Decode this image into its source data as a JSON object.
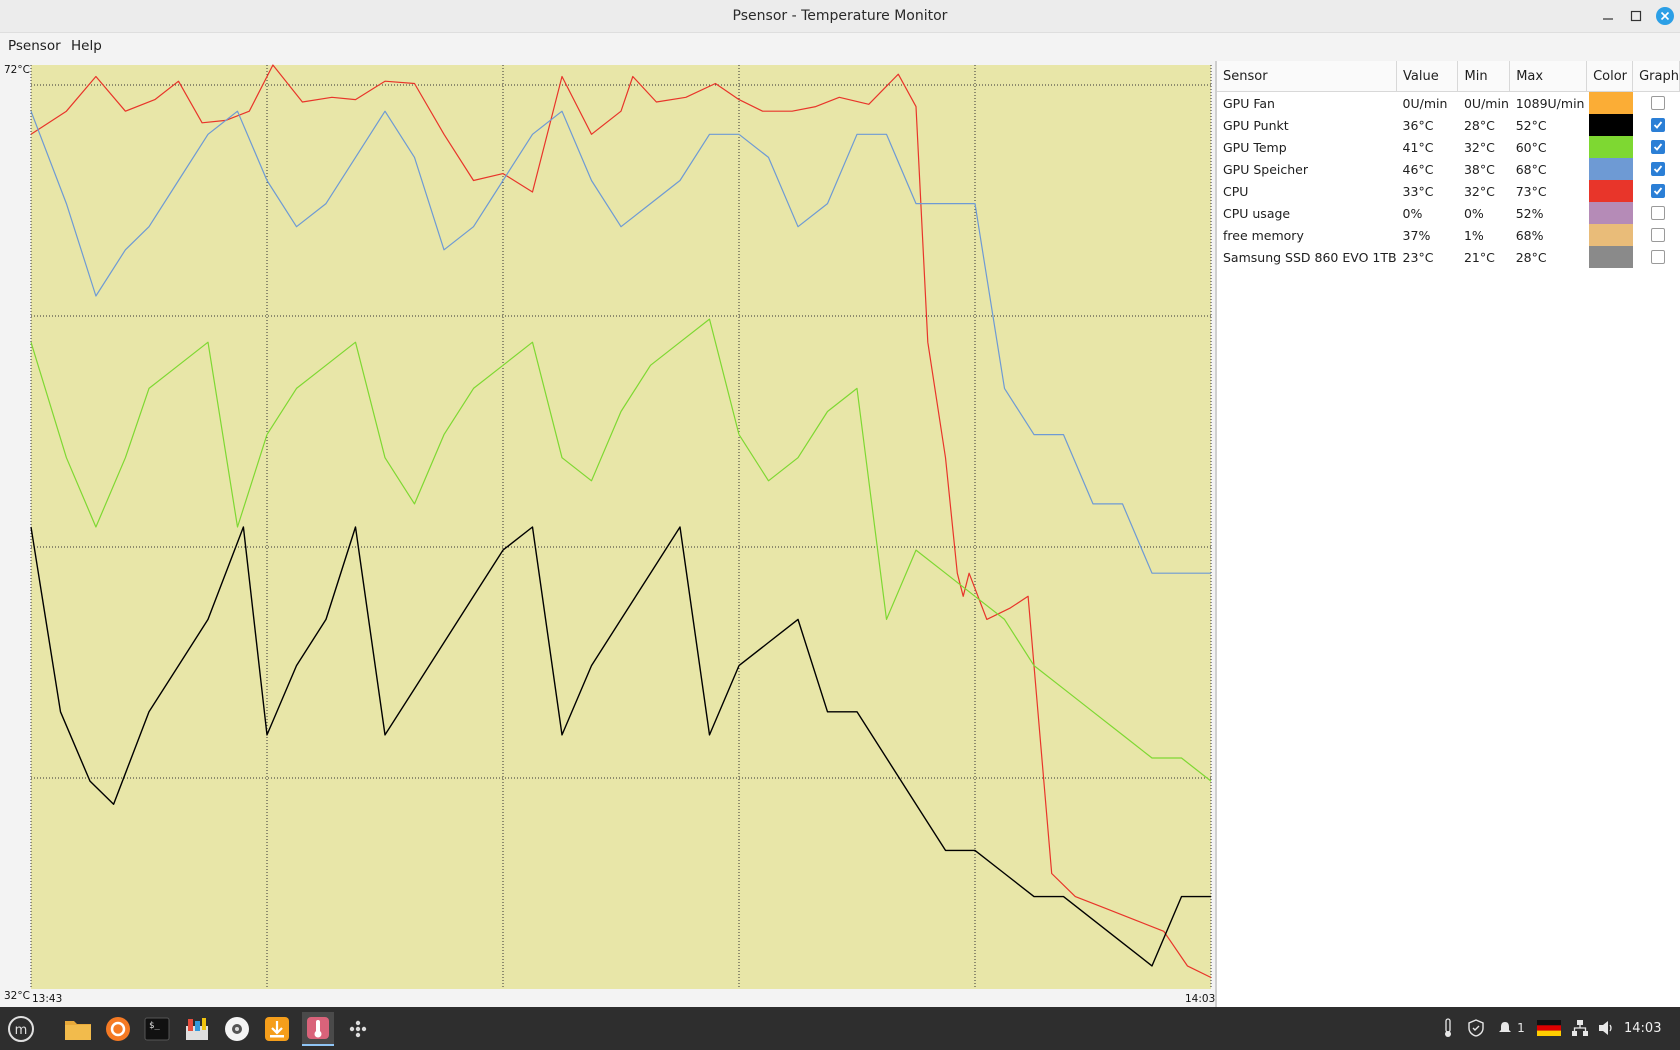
{
  "window": {
    "title": "Psensor - Temperature Monitor",
    "controls": [
      "minimize",
      "maximize",
      "close"
    ]
  },
  "menu": {
    "items": [
      "Psensor",
      "Help"
    ]
  },
  "graph": {
    "y_max_label": "72°C",
    "y_min_label": "32°C",
    "x_start_label": "13:43",
    "x_end_label": "14:03",
    "background_color": "#e8e6a8"
  },
  "chart_data": {
    "type": "line",
    "xlabel": "",
    "ylabel": "",
    "x_range": [
      "13:43",
      "14:03"
    ],
    "ylim": [
      32,
      72
    ],
    "series": [
      {
        "name": "CPU",
        "color": "#e8352a",
        "x": [
          0,
          0.6,
          1.1,
          1.6,
          2.1,
          2.5,
          2.9,
          3.3,
          3.7,
          4.1,
          4.6,
          5.1,
          5.5,
          6.0,
          6.5,
          7.0,
          7.5,
          8.0,
          8.5,
          9.0,
          9.5,
          10.0,
          10.2,
          10.6,
          11.1,
          11.6,
          12.0,
          12.4,
          12.9,
          13.3,
          13.7,
          14.2,
          14.7,
          15.0,
          15.2,
          15.5,
          15.7,
          15.8,
          15.9,
          16.2,
          16.6,
          16.9,
          17.3,
          17.7,
          18.2,
          18.7,
          19.2,
          19.6,
          20.0
        ],
        "values": [
          69,
          70,
          71.5,
          70,
          70.5,
          71.3,
          69.5,
          69.6,
          70,
          72,
          70.4,
          70.6,
          70.5,
          71.3,
          71.2,
          69,
          67,
          67.3,
          66.5,
          71.5,
          69,
          70,
          71.5,
          70.4,
          70.6,
          71.2,
          70.5,
          70,
          70,
          70.2,
          70.6,
          70.3,
          71.6,
          70.2,
          60,
          55,
          50,
          49,
          50,
          48,
          48.5,
          49,
          37,
          36,
          35.5,
          35,
          34.5,
          33,
          32.5
        ]
      },
      {
        "name": "GPU Speicher",
        "color": "#6e9ad4",
        "x": [
          0,
          0.6,
          1.1,
          1.6,
          2.0,
          2.5,
          3.0,
          3.5,
          4.0,
          4.5,
          5.0,
          5.5,
          6.0,
          6.5,
          7.0,
          7.5,
          8.0,
          8.5,
          9.0,
          9.5,
          10.0,
          10.5,
          11.0,
          11.5,
          12.0,
          12.5,
          13.0,
          13.5,
          14.0,
          14.5,
          15.0,
          15.5,
          16.0,
          16.5,
          17.0,
          17.5,
          18.0,
          18.5,
          19.0,
          19.5,
          20.0
        ],
        "values": [
          70,
          66,
          62,
          64,
          65,
          67,
          69,
          70,
          67,
          65,
          66,
          68,
          70,
          68,
          64,
          65,
          67,
          69,
          70,
          67,
          65,
          66,
          67,
          69,
          69,
          68,
          65,
          66,
          69,
          69,
          66,
          66,
          66,
          58,
          56,
          56,
          53,
          53,
          50,
          50,
          50
        ]
      },
      {
        "name": "GPU Temp",
        "color": "#7ed832",
        "x": [
          0,
          0.6,
          1.1,
          1.6,
          2.0,
          2.5,
          3.0,
          3.5,
          4.0,
          4.5,
          5.0,
          5.5,
          6.0,
          6.5,
          7.0,
          7.5,
          8.0,
          8.5,
          9.0,
          9.5,
          10.0,
          10.5,
          11.0,
          11.5,
          12.0,
          12.5,
          13.0,
          13.5,
          14.0,
          14.5,
          15.0,
          15.5,
          16.0,
          16.5,
          17.0,
          17.5,
          18.0,
          18.5,
          19.0,
          19.5,
          20.0
        ],
        "values": [
          60,
          55,
          52,
          55,
          58,
          59,
          60,
          52,
          56,
          58,
          59,
          60,
          55,
          53,
          56,
          58,
          59,
          60,
          55,
          54,
          57,
          59,
          60,
          61,
          56,
          54,
          55,
          57,
          58,
          48,
          51,
          50,
          49,
          48,
          46,
          45,
          44,
          43,
          42,
          42,
          41
        ]
      },
      {
        "name": "GPU Punkt",
        "color": "#000000",
        "x": [
          0,
          0.5,
          1.0,
          1.4,
          2.0,
          2.5,
          3.0,
          3.6,
          4.0,
          4.5,
          5.0,
          5.5,
          6.0,
          6.5,
          7.0,
          7.5,
          8.0,
          8.5,
          9.0,
          9.5,
          10.0,
          10.5,
          11.0,
          11.5,
          12.0,
          12.5,
          13.0,
          13.5,
          14.0,
          14.5,
          15.0,
          15.5,
          16.0,
          16.5,
          17.0,
          17.5,
          18.0,
          18.5,
          19.0,
          19.5,
          20.0
        ],
        "values": [
          52,
          44,
          41,
          40,
          44,
          46,
          48,
          52,
          43,
          46,
          48,
          52,
          43,
          45,
          47,
          49,
          51,
          52,
          43,
          46,
          48,
          50,
          52,
          43,
          46,
          47,
          48,
          44,
          44,
          42,
          40,
          38,
          38,
          37,
          36,
          36,
          35,
          34,
          33,
          36,
          36
        ]
      }
    ]
  },
  "sensor_table": {
    "columns": [
      "Sensor",
      "Value",
      "Min",
      "Max",
      "Color",
      "Graph"
    ],
    "rows": [
      {
        "sensor": "GPU Fan",
        "value": "0U/min",
        "min": "0U/min",
        "max": "1089U/min",
        "color": "#fbad36",
        "graph": false
      },
      {
        "sensor": "GPU Punkt",
        "value": "36°C",
        "min": "28°C",
        "max": "52°C",
        "color": "#000000",
        "graph": true
      },
      {
        "sensor": "GPU Temp",
        "value": "41°C",
        "min": "32°C",
        "max": "60°C",
        "color": "#7ed832",
        "graph": true
      },
      {
        "sensor": "GPU Speicher",
        "value": "46°C",
        "min": "38°C",
        "max": "68°C",
        "color": "#6e9ad4",
        "graph": true
      },
      {
        "sensor": "CPU",
        "value": "33°C",
        "min": "32°C",
        "max": "73°C",
        "color": "#e8352a",
        "graph": true
      },
      {
        "sensor": "CPU usage",
        "value": "0%",
        "min": "0%",
        "max": "52%",
        "color": "#b58bb7",
        "graph": false
      },
      {
        "sensor": "free memory",
        "value": "37%",
        "min": "1%",
        "max": "68%",
        "color": "#e9bc79",
        "graph": false
      },
      {
        "sensor": "Samsung SSD 860 EVO 1TB",
        "value": "23°C",
        "min": "21°C",
        "max": "28°C",
        "color": "#8a8a8a",
        "graph": false
      }
    ]
  },
  "taskbar": {
    "apps": [
      "mint-menu-icon",
      "files-icon",
      "firefox-icon",
      "terminal-icon",
      "paint-icon",
      "disc-icon",
      "installer-icon",
      "psensor-icon",
      "dots-icon"
    ],
    "tray": {
      "notification_count": "1",
      "clock": "14:03"
    }
  }
}
